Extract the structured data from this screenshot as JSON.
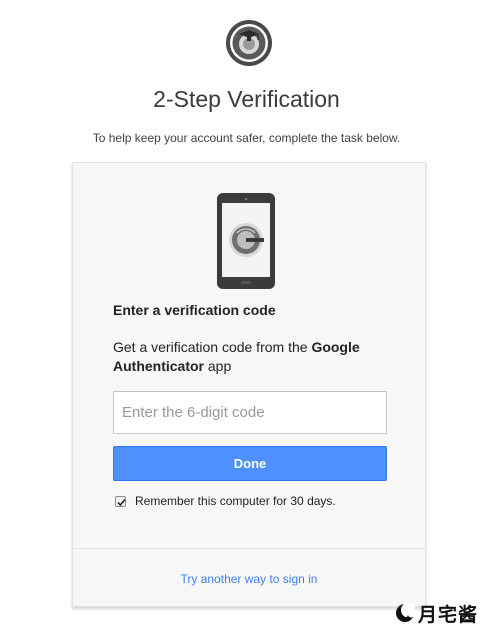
{
  "header": {
    "logo_icon": "site-logo-icon",
    "title": "2-Step Verification",
    "subtitle": "To help keep your account safer, complete the task below."
  },
  "card": {
    "phone_icon": "phone-authenticator-icon",
    "heading": "Enter a verification code",
    "desc_prefix": "Get a verification code from the ",
    "desc_app_name": "Google Authenticator",
    "desc_suffix": " app",
    "code_input": {
      "placeholder": "Enter the 6-digit code",
      "value": ""
    },
    "done_label": "Done",
    "remember": {
      "checked": true,
      "label": "Remember this computer for 30 days."
    },
    "alt_link": "Try another way to sign in"
  },
  "watermark": {
    "icon": "crescent-moon-icon",
    "text": "月宅酱"
  },
  "colors": {
    "accent": "#4d90fe",
    "link": "#427fed",
    "card_bg": "#f7f7f7"
  }
}
